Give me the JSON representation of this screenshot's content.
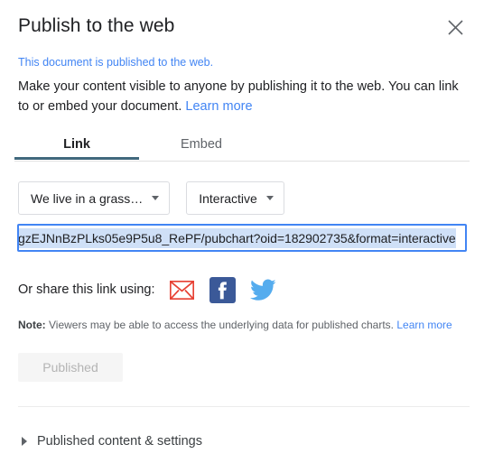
{
  "dialog": {
    "title": "Publish to the web",
    "close_icon": "close-icon",
    "status_text": "This document is published to the web.",
    "description_part1": "Make your content visible to anyone by publishing it to the web. You can link to or embed your document.",
    "description_link": "Learn more"
  },
  "tabs": [
    {
      "label": "Link",
      "active": true
    },
    {
      "label": "Embed",
      "active": false
    }
  ],
  "dropdowns": [
    {
      "name": "sheet-selector",
      "value": "We live in a grass…"
    },
    {
      "name": "format-selector",
      "value": "Interactive"
    }
  ],
  "url_field": {
    "value": "gzEJNnBzPLks05e9P5u8_RePF/pubchart?oid=182902735&format=interactive",
    "selected": true
  },
  "share": {
    "label": "Or share this link using:",
    "icons": [
      {
        "name": "gmail-icon",
        "label": "Gmail"
      },
      {
        "name": "facebook-icon",
        "label": "Facebook"
      },
      {
        "name": "twitter-icon",
        "label": "Twitter"
      }
    ]
  },
  "note": {
    "prefix": "Note:",
    "text": "Viewers may be able to access the underlying data for published charts.",
    "link": "Learn more"
  },
  "publish_button": {
    "label": "Published",
    "disabled": true
  },
  "expander": {
    "label": "Published content & settings",
    "expanded": false
  },
  "colors": {
    "link_blue": "#4285f4",
    "tab_underline": "#41697d",
    "focus_border": "#4285f4",
    "selection_highlight": "#cfe0f7",
    "gmail_red": "#e74134",
    "facebook_blue": "#3b5998",
    "twitter_blue": "#55acee",
    "disabled_button_bg": "#f5f5f5",
    "disabled_button_text": "#b4b4b4"
  }
}
